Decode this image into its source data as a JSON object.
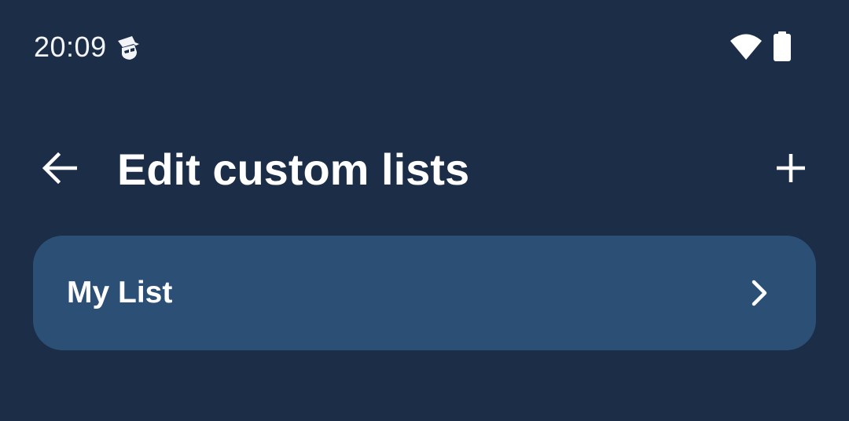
{
  "status_bar": {
    "time": "20:09",
    "icons": [
      "incognito-icon",
      "wifi-icon",
      "battery-icon"
    ]
  },
  "app_bar": {
    "title": "Edit custom lists",
    "back_icon": "arrow-back-icon",
    "add_icon": "plus-icon"
  },
  "lists": [
    {
      "label": "My List",
      "trailing_icon": "chevron-right-icon"
    }
  ],
  "colors": {
    "background": "#1b2d47",
    "list_item_bg": "#2c5075",
    "text": "#ffffff"
  }
}
